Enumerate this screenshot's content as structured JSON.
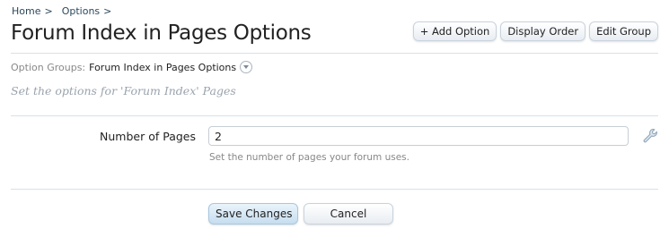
{
  "breadcrumb": {
    "items": [
      "Home",
      "Options"
    ],
    "separator": ">"
  },
  "page": {
    "title": "Forum Index in Pages Options"
  },
  "top_buttons": {
    "add_option": "+ Add Option",
    "display_order": "Display Order",
    "edit_group": "Edit Group"
  },
  "option_groups": {
    "label": "Option Groups:",
    "current": "Forum Index in Pages Options"
  },
  "group_description": "Set the options for 'Forum Index' Pages",
  "field": {
    "label": "Number of Pages",
    "value": "2",
    "hint": "Set the number of pages your forum uses."
  },
  "footer_buttons": {
    "save": "Save Changes",
    "cancel": "Cancel"
  },
  "colors": {
    "link": "#2b485c",
    "rule": "#d7e1ea",
    "muted": "#888888"
  },
  "icons": {
    "group_menu": "chevron-down-circle-icon",
    "edit_option": "wrench-icon"
  }
}
